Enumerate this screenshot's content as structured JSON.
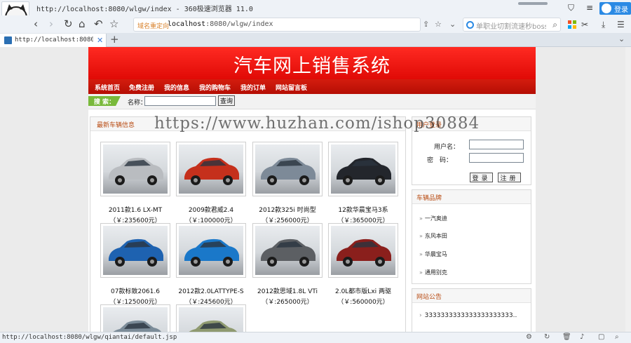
{
  "browser": {
    "title": "http://localhost:8080/wlgw/index - 360极速浏览器 11.0",
    "login_label": "登录",
    "address_tag": "域名重定向",
    "address_host": "localhost",
    "address_rest": ":8080/wlgw/index",
    "search_placeholder": "单职业切割流速秒boss",
    "tab_title": "http://localhost:8080/wlgw/i",
    "status_url": "http://localhost:8080/wlgw/qiantai/default.jsp",
    "colors": {
      "chrome": "#eef2f7",
      "accent": "#2b8ae4"
    }
  },
  "site": {
    "banner_title": "汽车网上销售系统",
    "menu": [
      {
        "label": "系统首页"
      },
      {
        "label": "免费注册"
      },
      {
        "label": "我的信息"
      },
      {
        "label": "我的购物车"
      },
      {
        "label": "我的订单"
      },
      {
        "label": "网站留言板"
      }
    ],
    "search": {
      "tag": "搜 索：",
      "label": "名称：",
      "value": "",
      "button": "查询"
    },
    "latest": {
      "heading": "最新车辆信息",
      "cars": [
        {
          "name": "2011款1.6 LX-MT",
          "price": "（￥:235600元）",
          "color": "#b9bcc0"
        },
        {
          "name": "2009款君威2.4",
          "price": "（￥:100000元）",
          "color": "#c5301c"
        },
        {
          "name": "2012款325i 时尚型",
          "price": "（￥:256000元）",
          "color": "#7d8a98"
        },
        {
          "name": "12款华晨宝马3系",
          "price": "（￥:365000元）",
          "color": "#23262c"
        },
        {
          "name": "07款标致2061.6",
          "price": "（￥:125000元）",
          "color": "#1e62b0"
        },
        {
          "name": "2012款2.0LATTYPE-S",
          "price": "（￥:245600元）",
          "color": "#1a78c9"
        },
        {
          "name": "2012款思域1.8L VTi",
          "price": "（￥:265000元）",
          "color": "#5c5f63"
        },
        {
          "name": "2.0L都市版Lxi 两驱",
          "price": "（￥:560000元）",
          "color": "#8a1f1c"
        },
        {
          "name": "",
          "price": "",
          "color": "#7c8c99"
        },
        {
          "name": "",
          "price": "",
          "color": "#8f9a70"
        }
      ]
    },
    "login_panel": {
      "heading": "用户登录",
      "username_label": "用户名：",
      "password_label": "密　码：",
      "login_button": "登录",
      "register_button": "注册"
    },
    "brands": {
      "heading": "车辆品牌",
      "items": [
        {
          "label": "一汽奥迪"
        },
        {
          "label": "东风本田"
        },
        {
          "label": "华晨宝马"
        },
        {
          "label": "通用别克"
        }
      ]
    },
    "notices": {
      "heading": "网站公告",
      "items": [
        {
          "label": "3333333333333333333333.."
        }
      ]
    },
    "watermark": "https://www.huzhan.com/ishop30884"
  }
}
